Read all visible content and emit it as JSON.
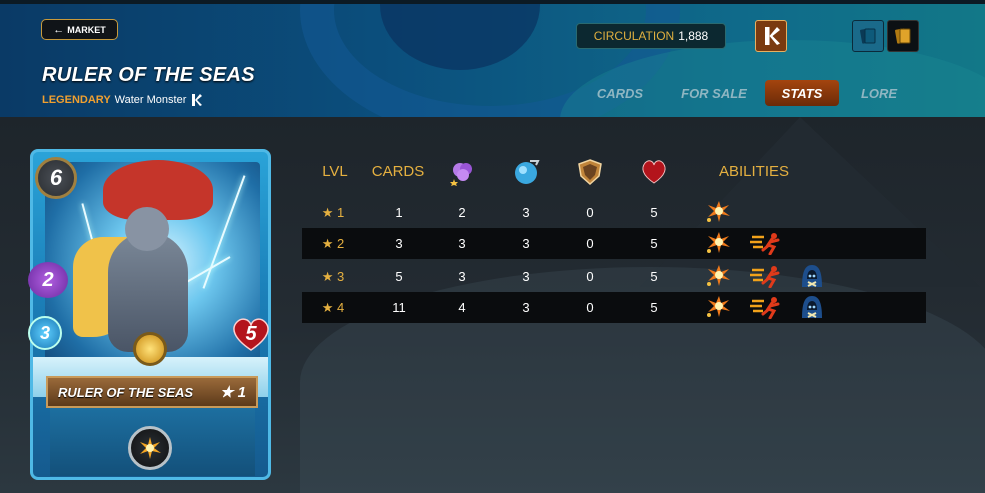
{
  "header": {
    "market_label": "MARKET",
    "card_name": "RULER OF THE SEAS",
    "rarity": "LEGENDARY",
    "type_label": "Water Monster",
    "circulation_label": "CIRCULATION",
    "circulation_value": "1,888"
  },
  "tabs": [
    {
      "label": "CARDS",
      "active": false
    },
    {
      "label": "FOR SALE",
      "active": false
    },
    {
      "label": "STATS",
      "active": true
    },
    {
      "label": "LORE",
      "active": false
    }
  ],
  "card": {
    "mana": "6",
    "magic": "2",
    "speed": "3",
    "health": "5",
    "banner_name": "RULER OF THE SEAS",
    "banner_level": "★ 1"
  },
  "table": {
    "headers": {
      "lvl": "LVL",
      "cards": "CARDS",
      "abilities": "ABILITIES"
    },
    "stat_icons": [
      "magic-icon",
      "speed-icon",
      "armor-icon",
      "health-icon"
    ],
    "rows": [
      {
        "lvl": "★ 1",
        "cards": "1",
        "magic": "2",
        "speed": "3",
        "armor": "0",
        "health": "5",
        "abilities": [
          "blast-icon"
        ]
      },
      {
        "lvl": "★ 2",
        "cards": "3",
        "magic": "3",
        "speed": "3",
        "armor": "0",
        "health": "5",
        "abilities": [
          "blast-icon",
          "swiftness-icon"
        ]
      },
      {
        "lvl": "★ 3",
        "cards": "5",
        "magic": "3",
        "speed": "3",
        "armor": "0",
        "health": "5",
        "abilities": [
          "blast-icon",
          "swiftness-icon",
          "hooded-skull-icon"
        ]
      },
      {
        "lvl": "★ 4",
        "cards": "11",
        "magic": "4",
        "speed": "3",
        "armor": "0",
        "health": "5",
        "abilities": [
          "blast-icon",
          "swiftness-icon",
          "hooded-skull-icon"
        ]
      }
    ]
  },
  "colors": {
    "accent_gold": "#e5b040",
    "rarity_orange": "#f0a030",
    "active_tab": "#a4450e"
  }
}
